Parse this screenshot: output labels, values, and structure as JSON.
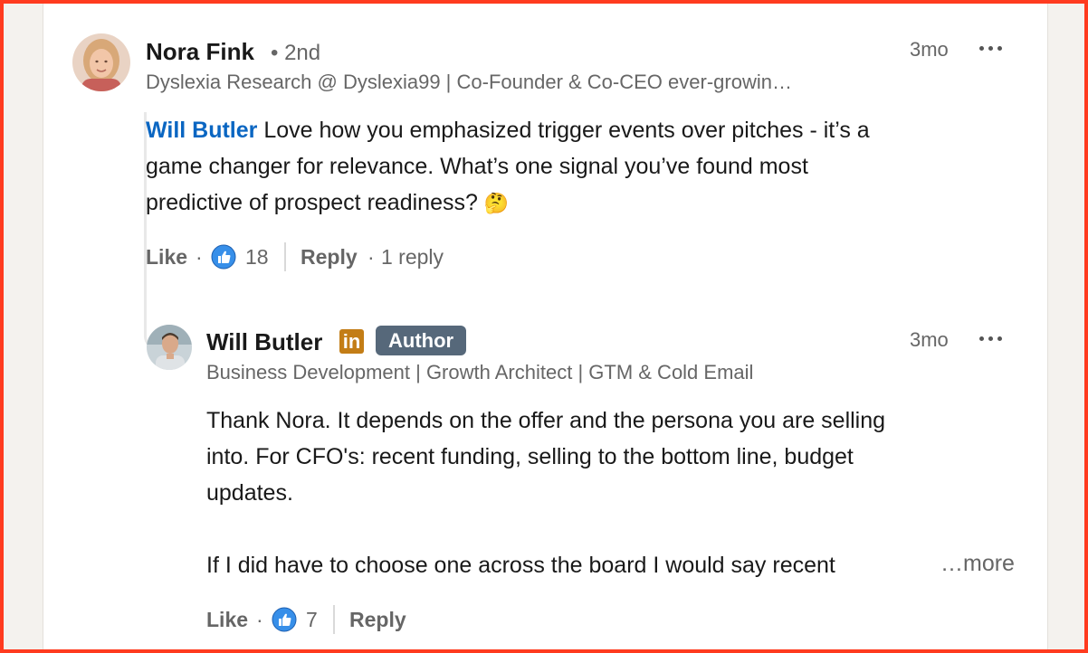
{
  "comment": {
    "author": "Nora Fink",
    "degree": "• 2nd",
    "headline": "Dyslexia Research @ Dyslexia99 | Co-Founder & Co-CEO ever-growin…",
    "time": "3mo",
    "mention": "Will Butler",
    "text_line1": "Love how you emphasized trigger events over pitches - it’s a",
    "text_line2": "game changer for relevance. What’s one signal you’ve found most",
    "text_line3": "predictive of prospect readiness?",
    "emoji": "🤔",
    "like_label": "Like",
    "reaction_count": "18",
    "reply_label": "Reply",
    "replies_count": "1 reply"
  },
  "reply": {
    "author": "Will Butler",
    "linkedin_badge": "in",
    "author_badge": "Author",
    "headline": "Business Development | Growth Architect | GTM & Cold Email",
    "time": "3mo",
    "text_line1": "Thank Nora. It depends on the offer and the persona you are selling",
    "text_line2": "into. For CFO's: recent funding, selling to the bottom line, budget",
    "text_line3": "updates.",
    "text_line4": "If I did have to choose one across the board I would say recent",
    "more_label": "…more",
    "like_label": "Like",
    "reaction_count": "7",
    "reply_label": "Reply"
  },
  "colors": {
    "accent_link": "#0a66c2",
    "author_badge": "#56687a",
    "highlight_border": "#ff3b1f"
  }
}
